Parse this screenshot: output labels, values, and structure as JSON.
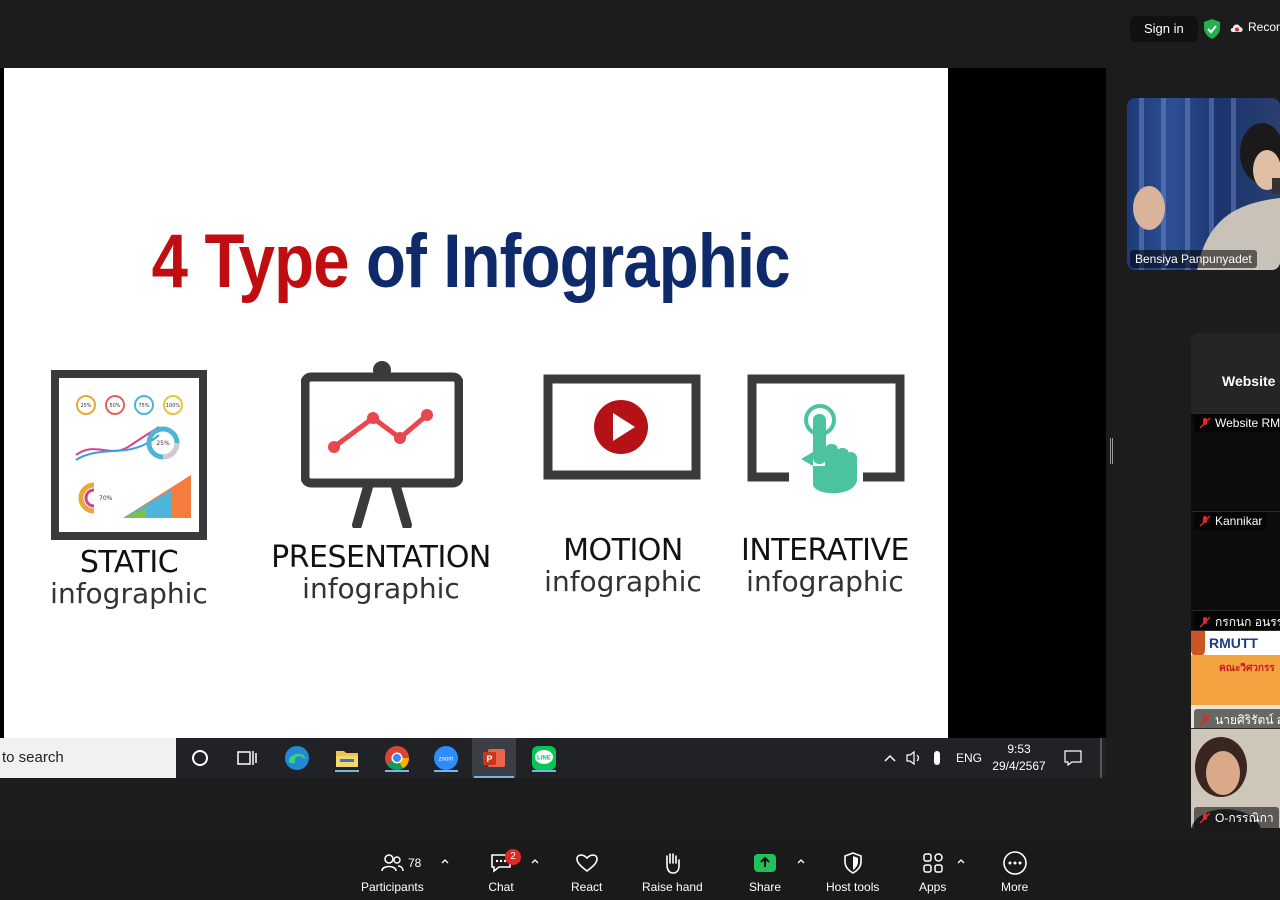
{
  "topbar": {
    "signin_label": "Sign in",
    "record_label": "Recor"
  },
  "slide": {
    "title_red": "4 Type",
    "title_blue": "of Infographic",
    "types": [
      {
        "name": "STATIC",
        "sub": "infographic"
      },
      {
        "name": "PRESENTATION",
        "sub": "infographic"
      },
      {
        "name": "MOTION",
        "sub": "infographic"
      },
      {
        "name": "INTERATIVE",
        "sub": "infographic"
      }
    ],
    "static_chart": {
      "rings": [
        "25%",
        "50%",
        "75%",
        "100%"
      ],
      "donut": "25%",
      "gauge": "70%"
    }
  },
  "taskbar": {
    "search_text": "to search",
    "lang": "ENG",
    "time": "9:53",
    "date": "29/4/2567",
    "zoom_label": "zoom",
    "line_label": "LINE"
  },
  "speaker": {
    "name": "Bensiya Panpunyadet"
  },
  "gallery": {
    "title": "Website",
    "participants": [
      {
        "name": "Website RM"
      },
      {
        "name": "Kannikar"
      },
      {
        "name": "กรกนก อนรร"
      },
      {
        "name": "นายศิริรัตน์ ส"
      },
      {
        "name": "O-กรรณิกา"
      }
    ],
    "banner_text": "RMUTT",
    "banner_sub": "คณะวิศวกรร"
  },
  "toolbar": {
    "participants_label": "Participants",
    "participants_count": "78",
    "chat_label": "Chat",
    "chat_badge": "2",
    "react_label": "React",
    "raise_hand_label": "Raise hand",
    "share_label": "Share",
    "host_tools_label": "Host tools",
    "apps_label": "Apps",
    "more_label": "More"
  },
  "colors": {
    "title_red": "#c00d12",
    "title_blue": "#0f2a6b",
    "share_green": "#23c05a",
    "badge_red": "#e02828"
  }
}
